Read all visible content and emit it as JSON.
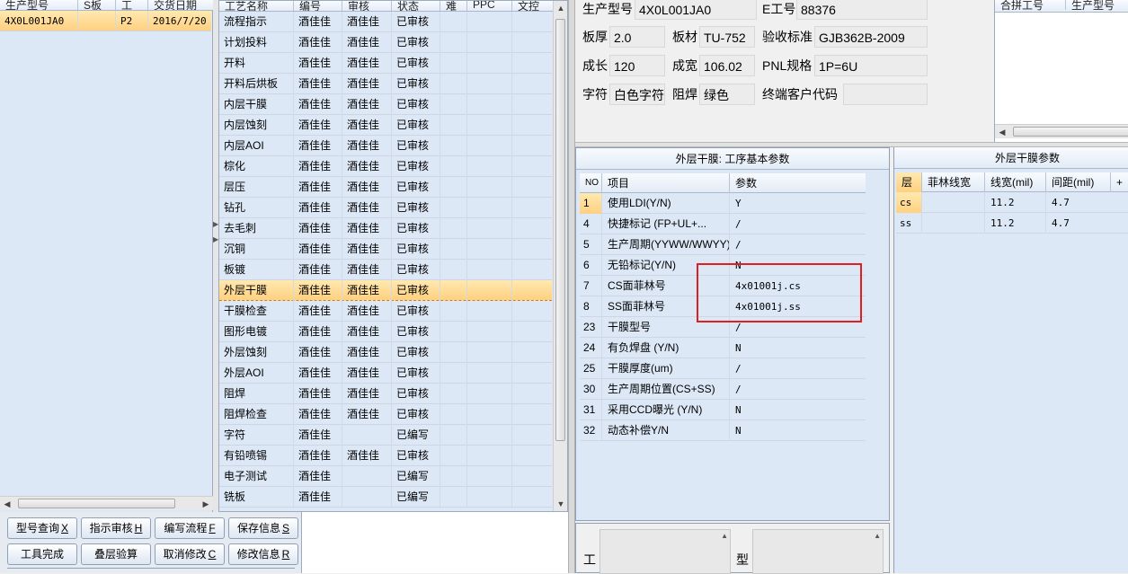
{
  "left_grid": {
    "headers": [
      "生产型号",
      "S板",
      "工",
      "交货日期"
    ],
    "rows": [
      {
        "model": "4X0L001JA0",
        "s": "",
        "g": "P2",
        "date": "2016/7/20"
      }
    ]
  },
  "process_grid": {
    "headers": [
      "工艺名称",
      "编号",
      "审核",
      "状态",
      "难",
      "PPC",
      "文控"
    ],
    "rows": [
      {
        "name": "流程指示",
        "code": "酒佳佳",
        "review": "酒佳佳",
        "status": "已审核"
      },
      {
        "name": "计划投料",
        "code": "酒佳佳",
        "review": "酒佳佳",
        "status": "已审核"
      },
      {
        "name": "开料",
        "code": "酒佳佳",
        "review": "酒佳佳",
        "status": "已审核"
      },
      {
        "name": "开料后烘板",
        "code": "酒佳佳",
        "review": "酒佳佳",
        "status": "已审核"
      },
      {
        "name": "内层干膜",
        "code": "酒佳佳",
        "review": "酒佳佳",
        "status": "已审核"
      },
      {
        "name": "内层蚀刻",
        "code": "酒佳佳",
        "review": "酒佳佳",
        "status": "已审核"
      },
      {
        "name": "内层AOI",
        "code": "酒佳佳",
        "review": "酒佳佳",
        "status": "已审核"
      },
      {
        "name": "棕化",
        "code": "酒佳佳",
        "review": "酒佳佳",
        "status": "已审核"
      },
      {
        "name": "层压",
        "code": "酒佳佳",
        "review": "酒佳佳",
        "status": "已审核"
      },
      {
        "name": "钻孔",
        "code": "酒佳佳",
        "review": "酒佳佳",
        "status": "已审核"
      },
      {
        "name": "去毛刺",
        "code": "酒佳佳",
        "review": "酒佳佳",
        "status": "已审核"
      },
      {
        "name": "沉铜",
        "code": "酒佳佳",
        "review": "酒佳佳",
        "status": "已审核"
      },
      {
        "name": "板镀",
        "code": "酒佳佳",
        "review": "酒佳佳",
        "status": "已审核"
      },
      {
        "name": "外层干膜",
        "code": "酒佳佳",
        "review": "酒佳佳",
        "status": "已审核"
      },
      {
        "name": "干膜检查",
        "code": "酒佳佳",
        "review": "酒佳佳",
        "status": "已审核"
      },
      {
        "name": "图形电镀",
        "code": "酒佳佳",
        "review": "酒佳佳",
        "status": "已审核"
      },
      {
        "name": "外层蚀刻",
        "code": "酒佳佳",
        "review": "酒佳佳",
        "status": "已审核"
      },
      {
        "name": "外层AOI",
        "code": "酒佳佳",
        "review": "酒佳佳",
        "status": "已审核"
      },
      {
        "name": "阻焊",
        "code": "酒佳佳",
        "review": "酒佳佳",
        "status": "已审核"
      },
      {
        "name": "阻焊检查",
        "code": "酒佳佳",
        "review": "酒佳佳",
        "status": "已审核"
      },
      {
        "name": "字符",
        "code": "酒佳佳",
        "review": "",
        "status": "已编写"
      },
      {
        "name": "有铅喷锡",
        "code": "酒佳佳",
        "review": "酒佳佳",
        "status": "已审核"
      },
      {
        "name": "电子测试",
        "code": "酒佳佳",
        "review": "",
        "status": "已编写"
      },
      {
        "name": "铣板",
        "code": "酒佳佳",
        "review": "",
        "status": "已编写"
      }
    ],
    "selected_index": 13
  },
  "buttons": {
    "row1": [
      {
        "label": "型号查询",
        "key": "X"
      },
      {
        "label": "指示审核",
        "key": "H"
      },
      {
        "label": "编写流程",
        "key": "F"
      },
      {
        "label": "保存信息",
        "key": "S"
      }
    ],
    "row2": [
      {
        "label": "工具完成",
        "key": ""
      },
      {
        "label": "叠层验算",
        "key": ""
      },
      {
        "label": "取消修改",
        "key": "C"
      },
      {
        "label": "修改信息",
        "key": "R"
      }
    ]
  },
  "info": {
    "model_label": "生产型号",
    "model_value": "4X0L001JA0",
    "eno_label": "E工号",
    "eno_value": "88376",
    "thickness_label": "板厚",
    "thickness_value": "2.0",
    "material_label": "板材",
    "material_value": "TU-752",
    "standard_label": "验收标准",
    "standard_value": "GJB362B-2009",
    "length_label": "成长",
    "length_value": "120",
    "width_label": "成宽",
    "width_value": "106.02",
    "pnl_label": "PNL规格",
    "pnl_value": "1P=6U",
    "char_label": "字符",
    "char_value": "白色字符",
    "mask_label": "阻焊",
    "mask_value": "绿色",
    "customer_label": "终端客户代码",
    "customer_value": ""
  },
  "merge_grid": {
    "headers": [
      "合拼工号",
      "生产型号"
    ]
  },
  "params_panel": {
    "title": "外层干膜: 工序基本参数",
    "headers": [
      "NO",
      "项目",
      "参数"
    ],
    "rows": [
      {
        "no": "1",
        "item": "使用LDI(Y/N)",
        "value": "Y"
      },
      {
        "no": "4",
        "item": "快捷标记 (FP+UL+...",
        "value": "/"
      },
      {
        "no": "5",
        "item": "生产周期(YYWW/WWYY)",
        "value": "/"
      },
      {
        "no": "6",
        "item": "无铅标记(Y/N)",
        "value": "N"
      },
      {
        "no": "7",
        "item": "CS面菲林号",
        "value": "4x01001j.cs"
      },
      {
        "no": "8",
        "item": "SS面菲林号",
        "value": "4x01001j.ss"
      },
      {
        "no": "23",
        "item": "干膜型号",
        "value": "/"
      },
      {
        "no": "24",
        "item": "有负焊盘 (Y/N)",
        "value": "N"
      },
      {
        "no": "25",
        "item": "干膜厚度(um)",
        "value": "/"
      },
      {
        "no": "30",
        "item": "生产周期位置(CS+SS)",
        "value": "/"
      },
      {
        "no": "31",
        "item": "采用CCD曝光 (Y/N)",
        "value": "N"
      },
      {
        "no": "32",
        "item": "动态补偿Y/N",
        "value": "N"
      }
    ],
    "selected_index": 0
  },
  "film_panel": {
    "title": "外层干膜参数",
    "headers": [
      "层",
      "菲林线宽",
      "线宽(mil)",
      "间距(mil)",
      "+"
    ],
    "rows": [
      {
        "layer": "cs",
        "film": "",
        "width": "11.2",
        "gap": "4.7"
      },
      {
        "layer": "ss",
        "film": "",
        "width": "11.2",
        "gap": "4.7"
      }
    ]
  },
  "bottom": {
    "work_label": "工",
    "type_label": "型"
  },
  "colors": {
    "grid_bg": "#dde8f6",
    "selection": "#ffd080",
    "highlight_box": "#e02020"
  }
}
